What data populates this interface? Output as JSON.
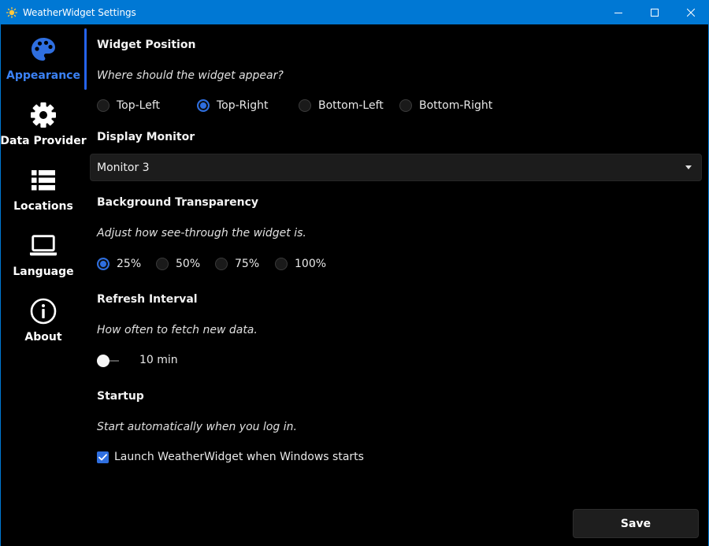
{
  "window": {
    "title": "WeatherWidget Settings"
  },
  "sidebar": {
    "items": [
      {
        "label": "Appearance",
        "icon": "palette-icon",
        "active": true
      },
      {
        "label": "Data Provider",
        "icon": "gear-icon",
        "active": false
      },
      {
        "label": "Locations",
        "icon": "list-icon",
        "active": false
      },
      {
        "label": "Language",
        "icon": "laptop-icon",
        "active": false
      },
      {
        "label": "About",
        "icon": "info-icon",
        "active": false
      }
    ]
  },
  "widget_position": {
    "title": "Widget Position",
    "description": "Where should the widget appear?",
    "options": [
      "Top-Left",
      "Top-Right",
      "Bottom-Left",
      "Bottom-Right"
    ],
    "selected": "Top-Right"
  },
  "display_monitor": {
    "title": "Display Monitor",
    "value": "Monitor 3"
  },
  "background_transparency": {
    "title": "Background Transparency",
    "description": "Adjust how see-through the widget is.",
    "options": [
      "25%",
      "50%",
      "75%",
      "100%"
    ],
    "selected": "25%"
  },
  "refresh_interval": {
    "title": "Refresh Interval",
    "description": "How often to fetch new data.",
    "value_label": "10 min",
    "slider_position": 0
  },
  "startup": {
    "title": "Startup",
    "description": "Start automatically when you log in.",
    "checkbox_label": "Launch WeatherWidget when Windows starts",
    "checked": true
  },
  "footer": {
    "save_label": "Save"
  },
  "colors": {
    "titlebar": "#0078d4",
    "accent": "#2f6fe0",
    "active_nav": "#3b82f6",
    "background": "#000000"
  }
}
